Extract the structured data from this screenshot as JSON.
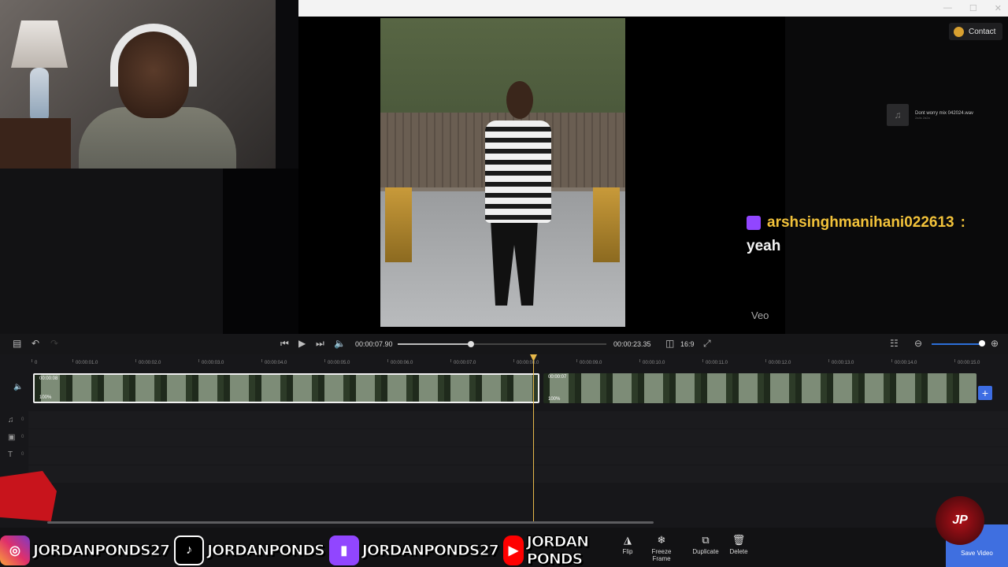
{
  "window": {
    "controls": [
      "—",
      "☐",
      "✕"
    ]
  },
  "header": {
    "contact_label": "Contact"
  },
  "music": {
    "name": "Dont worry mix 042024.wav",
    "sub": "2a4s 2a2a"
  },
  "chat": {
    "username": "arshsinghmanihani022613",
    "separator": ":",
    "message": "yeah"
  },
  "watermark": "Veo",
  "toolbar": {
    "current_time": "00:00:07.90",
    "total_time": "00:00:23.35",
    "aspect_ratio": "16:9",
    "playback_progress": 0.35,
    "zoom_level": 0.95
  },
  "ruler": {
    "ticks": [
      "0",
      "00:00:01.0",
      "00:00:02.0",
      "00:00:03.0",
      "00:00:04.0",
      "00:00:05.0",
      "00:00:06.0",
      "00:00:07.0",
      "00:00:08.0",
      "00:00:09.0",
      "00:00:10.0",
      "00:00:11.0",
      "00:00:12.0",
      "00:00:13.0",
      "00:00:14.0",
      "00:00:15.0"
    ]
  },
  "clips": [
    {
      "duration": "00:00:08",
      "speed": "100%"
    },
    {
      "duration": "00:00:07",
      "speed": "100%"
    }
  ],
  "tracks": [
    {
      "icon": "music-icon",
      "glyph": "♫",
      "count": "0"
    },
    {
      "icon": "sticker-icon",
      "glyph": "▣",
      "count": "0"
    },
    {
      "icon": "text-icon",
      "glyph": "T",
      "count": "0"
    }
  ],
  "actions": [
    {
      "name": "flip",
      "label": "Flip",
      "glyph": "◮"
    },
    {
      "name": "freeze-frame",
      "label": "Freeze\nFrame",
      "glyph": "❄"
    },
    {
      "name": "duplicate",
      "label": "Duplicate",
      "glyph": "⧉"
    },
    {
      "name": "delete",
      "label": "Delete",
      "glyph": "🗑"
    }
  ],
  "save_video_label": "Save Video",
  "socials": [
    {
      "platform": "instagram",
      "glyph": "◎",
      "handle": "JORDANPONDS27"
    },
    {
      "platform": "tiktok",
      "glyph": "♪",
      "handle": "JORDANPONDS"
    },
    {
      "platform": "twitch",
      "glyph": "▮",
      "handle": "JORDANPONDS27"
    },
    {
      "platform": "youtube",
      "glyph": "▶",
      "handle": "JORDAN PONDS"
    }
  ],
  "jp_logo_text": "JP",
  "colors": {
    "accent": "#3f6fe0",
    "playhead": "#e6b84a",
    "chat_name": "#f2c23a",
    "twitch": "#9146ff"
  }
}
